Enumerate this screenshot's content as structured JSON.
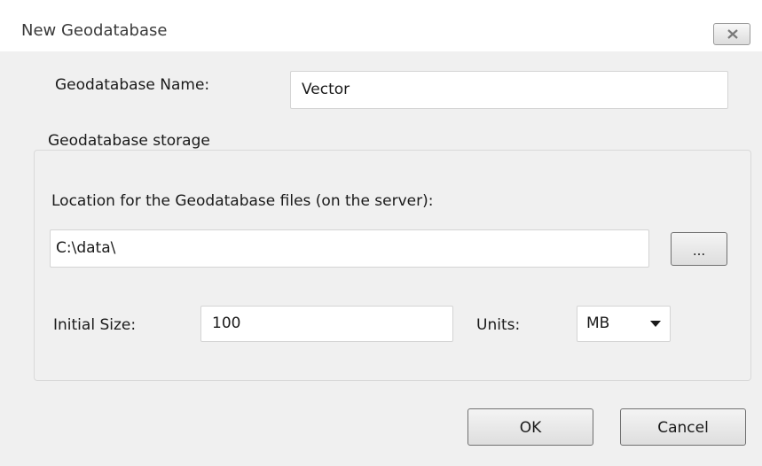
{
  "window": {
    "title": "New Geodatabase"
  },
  "form": {
    "name_label": "Geodatabase Name:",
    "name_value": "Vector",
    "storage_legend": "Geodatabase storage",
    "location_label": "Location for the Geodatabase files (on the server):",
    "location_value": "C:\\data\\",
    "browse_label": "...",
    "initial_size_label": "Initial Size:",
    "initial_size_value": "100",
    "units_label": "Units:",
    "units_value": "MB"
  },
  "buttons": {
    "ok": "OK",
    "cancel": "Cancel"
  },
  "icons": {
    "close": "close-icon",
    "dropdown": "chevron-down-icon"
  }
}
